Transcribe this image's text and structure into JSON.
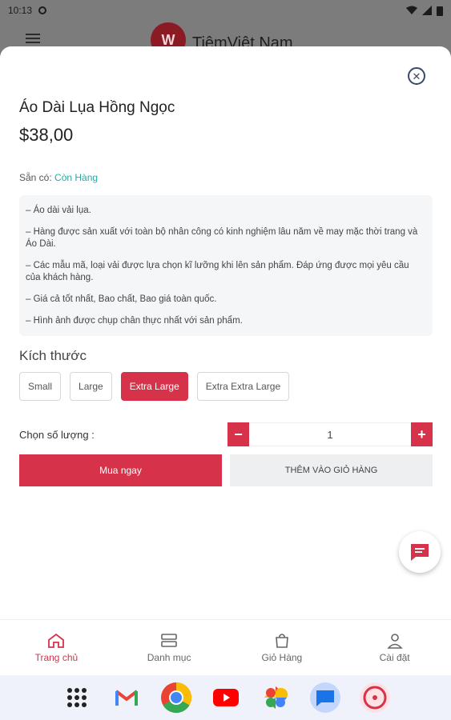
{
  "status_bar": {
    "time": "10:13"
  },
  "app_header": {
    "logo_text": "W",
    "brand_name": "TiệmViệt Nam"
  },
  "product": {
    "title": "Áo Dài Lụa Hồng Ngọc",
    "price": "$38,00",
    "stock_label": "Sẵn có:",
    "stock_value": "Còn Hàng",
    "description": [
      "– Áo dài vải lụa.",
      "– Hàng được sản xuất với toàn bộ nhân công có kinh nghiệm lâu năm về may mặc thời trang và Áo Dài.",
      "– Các mẫu mã, loại vải được lựa chọn kĩ lưỡng khi lên sản phẩm. Đáp ứng được mọi yêu cầu của khách hàng.",
      "– Giá cả tốt nhất, Bao chất, Bao giá toàn quốc.",
      "– Hình ảnh được chụp chân thực nhất với sản phẩm."
    ]
  },
  "size": {
    "label": "Kích thước",
    "options": [
      "Small",
      "Large",
      "Extra Large",
      "Extra Extra Large"
    ],
    "selected": "Extra Large"
  },
  "quantity": {
    "label": "Chọn số lượng :",
    "value": "1",
    "minus": "−",
    "plus": "+"
  },
  "actions": {
    "buy_now": "Mua ngay",
    "add_to_cart": "THÊM VÀO GIỎ HÀNG"
  },
  "bottom_nav": [
    {
      "label": "Trang chủ",
      "icon": "home-icon",
      "active": true
    },
    {
      "label": "Danh mục",
      "icon": "category-icon",
      "active": false
    },
    {
      "label": "Giỏ Hàng",
      "icon": "bag-icon",
      "active": false
    },
    {
      "label": "Cài đặt",
      "icon": "user-icon",
      "active": false
    }
  ],
  "dock_apps": [
    "apps-grid-icon",
    "gmail-icon",
    "chrome-icon",
    "youtube-icon",
    "photos-icon",
    "messages-icon",
    "camera-app-icon"
  ],
  "colors": {
    "accent": "#d6334b",
    "stock": "#2aa9a0"
  }
}
